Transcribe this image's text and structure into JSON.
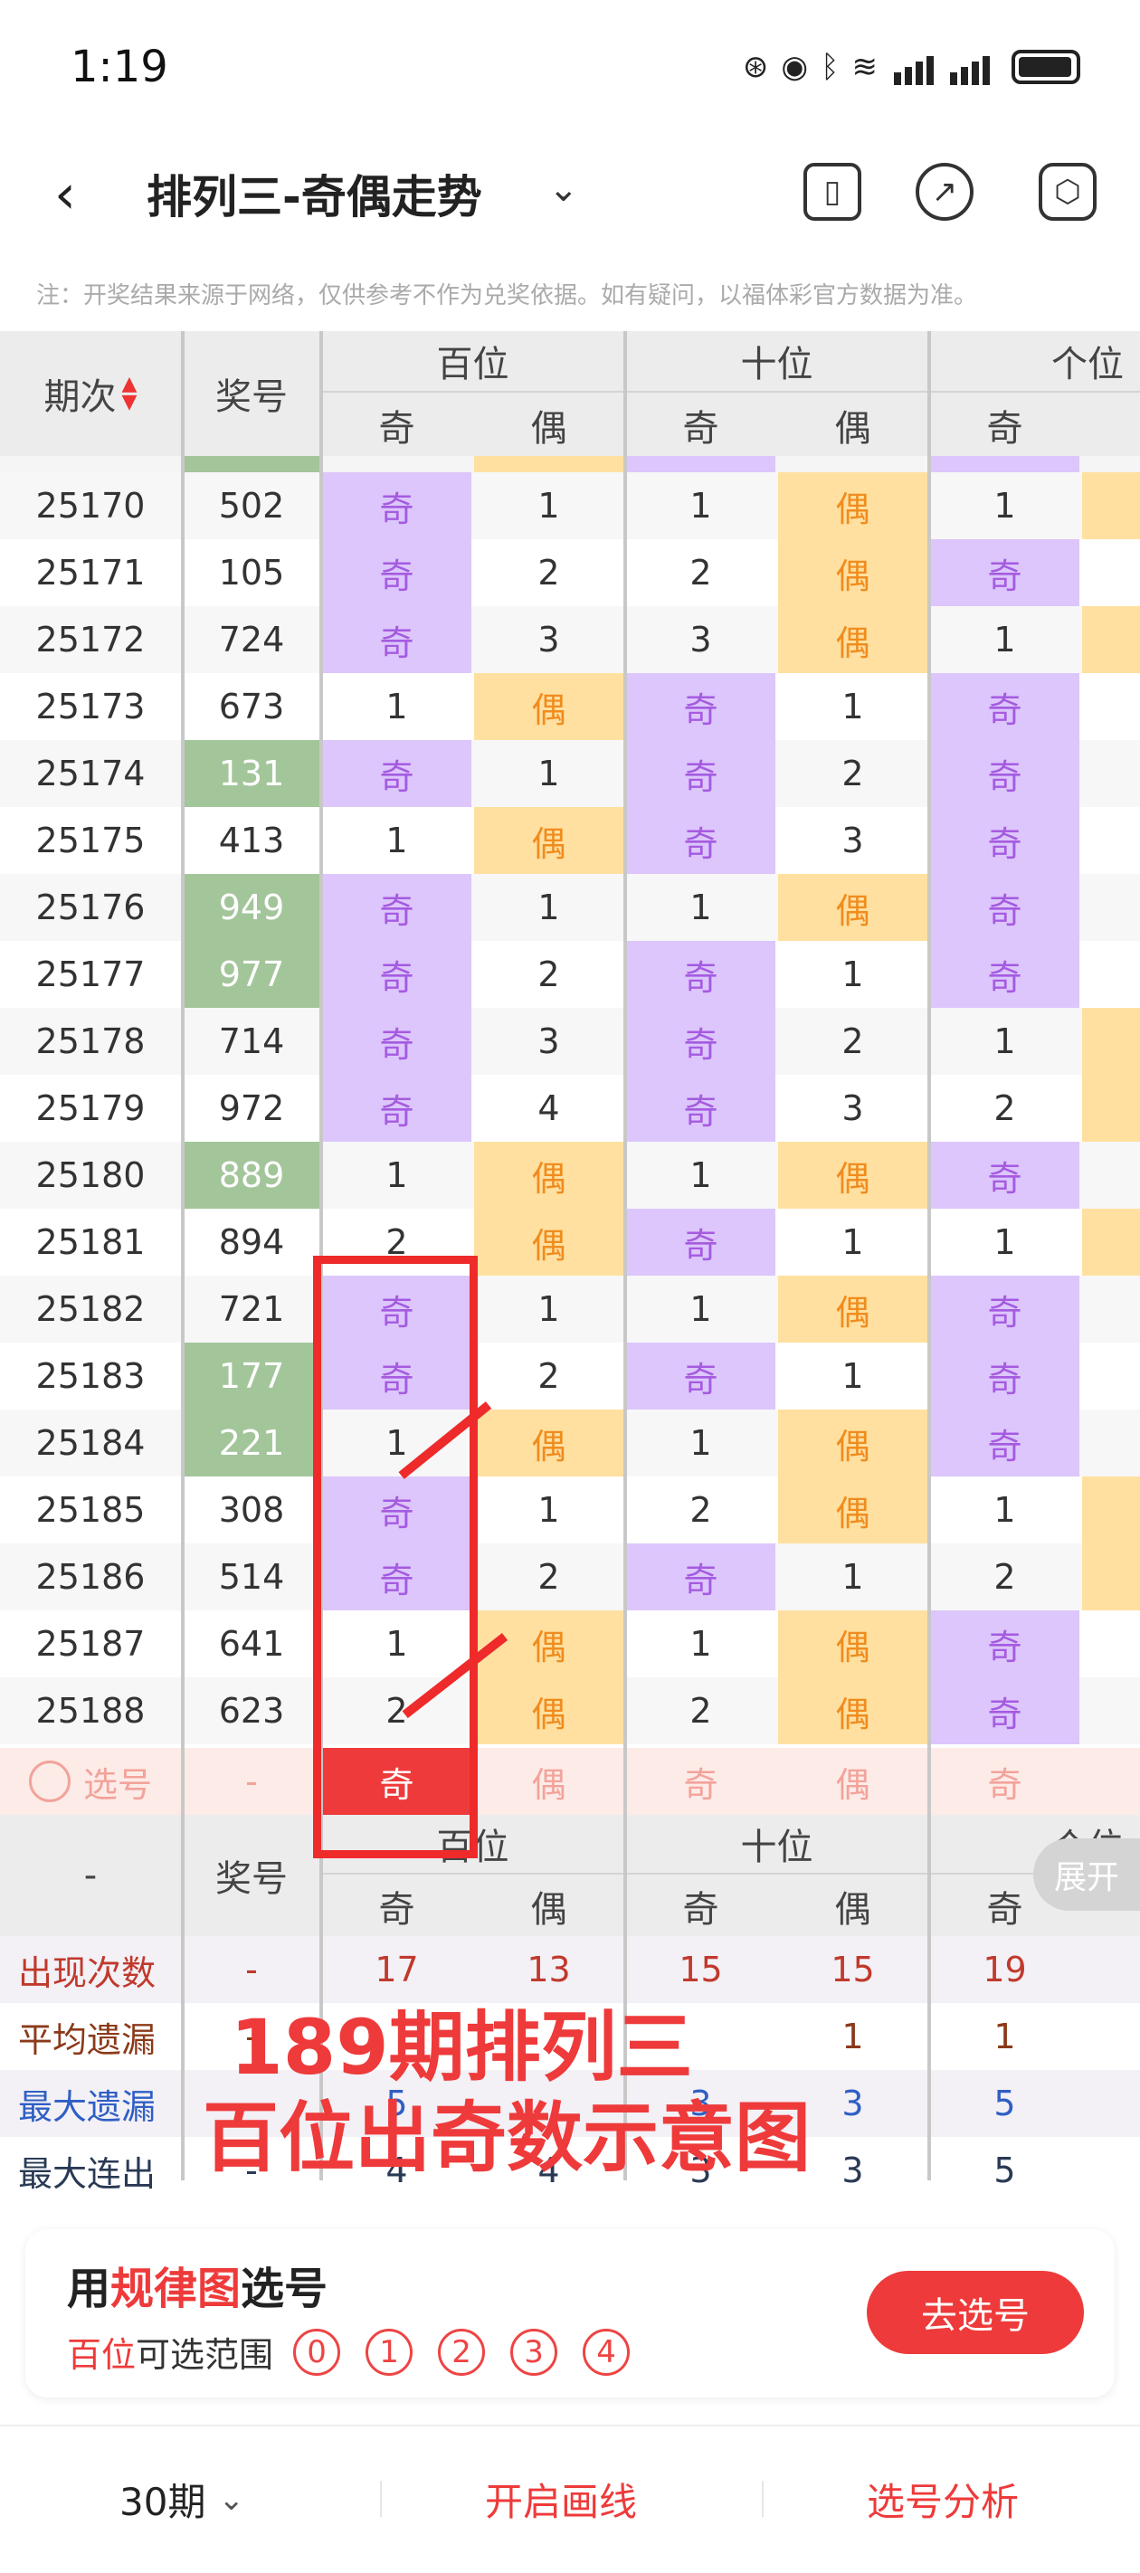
{
  "status": {
    "time": "1:19"
  },
  "header": {
    "title": "排列三-奇偶走势",
    "dropdown_icon": "chevron-down-icon"
  },
  "note": "注：开奖结果来源于网络，仅供参考不作为兑奖依据。如有疑问，以福体彩官方数据为准。",
  "table_header": {
    "period": "期次",
    "number": "奖号",
    "hundreds": "百位",
    "tens": "十位",
    "units": "个位",
    "odd": "奇",
    "even": "偶"
  },
  "rows": [
    {
      "p": "25170",
      "n": "502",
      "g": false,
      "h": [
        "奇",
        "1"
      ],
      "t": [
        "1",
        "偶"
      ],
      "u": [
        "1",
        ""
      ]
    },
    {
      "p": "25171",
      "n": "105",
      "g": false,
      "h": [
        "奇",
        "2"
      ],
      "t": [
        "2",
        "偶"
      ],
      "u": [
        "奇",
        ""
      ]
    },
    {
      "p": "25172",
      "n": "724",
      "g": false,
      "h": [
        "奇",
        "3"
      ],
      "t": [
        "3",
        "偶"
      ],
      "u": [
        "1",
        ""
      ]
    },
    {
      "p": "25173",
      "n": "673",
      "g": false,
      "h": [
        "1",
        "偶"
      ],
      "t": [
        "奇",
        "1"
      ],
      "u": [
        "奇",
        ""
      ]
    },
    {
      "p": "25174",
      "n": "131",
      "g": true,
      "h": [
        "奇",
        "1"
      ],
      "t": [
        "奇",
        "2"
      ],
      "u": [
        "奇",
        ""
      ]
    },
    {
      "p": "25175",
      "n": "413",
      "g": false,
      "h": [
        "1",
        "偶"
      ],
      "t": [
        "奇",
        "3"
      ],
      "u": [
        "奇",
        ""
      ]
    },
    {
      "p": "25176",
      "n": "949",
      "g": true,
      "h": [
        "奇",
        "1"
      ],
      "t": [
        "1",
        "偶"
      ],
      "u": [
        "奇",
        ""
      ]
    },
    {
      "p": "25177",
      "n": "977",
      "g": true,
      "h": [
        "奇",
        "2"
      ],
      "t": [
        "奇",
        "1"
      ],
      "u": [
        "奇",
        ""
      ]
    },
    {
      "p": "25178",
      "n": "714",
      "g": false,
      "h": [
        "奇",
        "3"
      ],
      "t": [
        "奇",
        "2"
      ],
      "u": [
        "1",
        ""
      ]
    },
    {
      "p": "25179",
      "n": "972",
      "g": false,
      "h": [
        "奇",
        "4"
      ],
      "t": [
        "奇",
        "3"
      ],
      "u": [
        "2",
        ""
      ]
    },
    {
      "p": "25180",
      "n": "889",
      "g": true,
      "h": [
        "1",
        "偶"
      ],
      "t": [
        "1",
        "偶"
      ],
      "u": [
        "奇",
        ""
      ]
    },
    {
      "p": "25181",
      "n": "894",
      "g": false,
      "h": [
        "2",
        "偶"
      ],
      "t": [
        "奇",
        "1"
      ],
      "u": [
        "1",
        ""
      ]
    },
    {
      "p": "25182",
      "n": "721",
      "g": false,
      "h": [
        "奇",
        "1"
      ],
      "t": [
        "1",
        "偶"
      ],
      "u": [
        "奇",
        ""
      ]
    },
    {
      "p": "25183",
      "n": "177",
      "g": true,
      "h": [
        "奇",
        "2"
      ],
      "t": [
        "奇",
        "1"
      ],
      "u": [
        "奇",
        ""
      ]
    },
    {
      "p": "25184",
      "n": "221",
      "g": true,
      "h": [
        "1",
        "偶"
      ],
      "t": [
        "1",
        "偶"
      ],
      "u": [
        "奇",
        ""
      ]
    },
    {
      "p": "25185",
      "n": "308",
      "g": false,
      "h": [
        "奇",
        "1"
      ],
      "t": [
        "2",
        "偶"
      ],
      "u": [
        "1",
        ""
      ]
    },
    {
      "p": "25186",
      "n": "514",
      "g": false,
      "h": [
        "奇",
        "2"
      ],
      "t": [
        "奇",
        "1"
      ],
      "u": [
        "2",
        ""
      ]
    },
    {
      "p": "25187",
      "n": "641",
      "g": false,
      "h": [
        "1",
        "偶"
      ],
      "t": [
        "1",
        "偶"
      ],
      "u": [
        "奇",
        ""
      ]
    },
    {
      "p": "25188",
      "n": "623",
      "g": false,
      "h": [
        "2",
        "偶"
      ],
      "t": [
        "2",
        "偶"
      ],
      "u": [
        "奇",
        ""
      ]
    }
  ],
  "pick_row": {
    "label": "选号",
    "number": "-",
    "cells": [
      "奇",
      "偶",
      "奇",
      "偶",
      "奇"
    ]
  },
  "stats_header": {
    "period": "-",
    "number": "奖号",
    "hundreds": "百位",
    "tens": "十位",
    "units": "个位",
    "expand": "展开"
  },
  "stats": [
    {
      "label": "出现次数",
      "dash": "-",
      "vals": [
        "17",
        "13",
        "15",
        "15",
        "19"
      ],
      "color": "#c0392b"
    },
    {
      "label": "平均遗漏",
      "dash": "-",
      "vals": [
        "",
        "",
        "",
        "1",
        "1"
      ],
      "color": "#8b3a1a"
    },
    {
      "label": "最大遗漏",
      "dash": "-",
      "vals": [
        "5",
        "",
        "3",
        "3",
        "5"
      ],
      "color": "#2f5fc4"
    },
    {
      "label": "最大连出",
      "dash": "-",
      "vals": [
        "4",
        "4",
        "3",
        "3",
        "5"
      ],
      "color": "#2a3a55"
    }
  ],
  "annotation": {
    "line1": "189期排列三",
    "line2": "百位出奇数示意图"
  },
  "card": {
    "title_pre": "用",
    "title_highlight": "规律图",
    "title_post": "选号",
    "range_highlight": "百位",
    "range_text": "可选范围",
    "balls": [
      "0",
      "1",
      "2",
      "3",
      "4"
    ],
    "button": "去选号"
  },
  "bottom": {
    "periods": "30期",
    "draw": "开启画线",
    "analysis": "选号分析"
  },
  "colors": {
    "odd_bg": "#dcc6fb",
    "even_bg": "#ffe0a0",
    "accent": "#ee3a3a",
    "green": "#a3c59a"
  }
}
